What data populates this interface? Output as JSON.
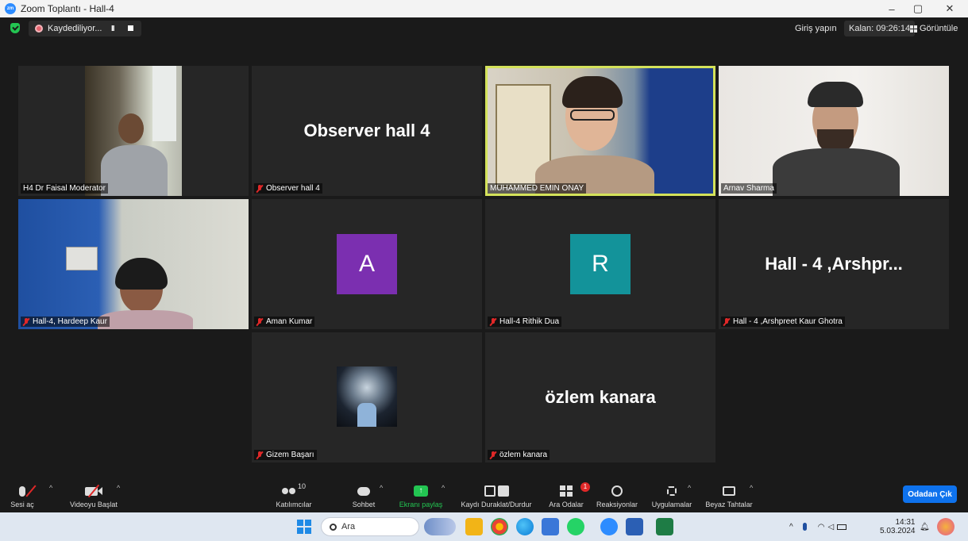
{
  "window": {
    "title": "Zoom Toplantı - Hall-4",
    "minimize": "–",
    "restore": "▢",
    "close": "✕"
  },
  "topbar": {
    "recording_label": "Kaydediliyor...",
    "pause_glyph": "II",
    "signin": "Giriş yapın",
    "remaining": "Kalan: 09:26:14",
    "view_label": "Görüntüle"
  },
  "tiles": [
    {
      "name": "H4 Dr Faisal Moderator",
      "muted": false,
      "type": "video"
    },
    {
      "name": "Observer hall 4",
      "display": "Observer hall 4",
      "muted": true,
      "type": "name"
    },
    {
      "name": "MUHAMMED EMIN ONAY",
      "muted": false,
      "type": "video",
      "active": true
    },
    {
      "name": "Arnav Sharma",
      "muted": false,
      "type": "video"
    },
    {
      "name": "Hall-4, Hardeep Kaur",
      "muted": true,
      "type": "video"
    },
    {
      "name": "Aman Kumar",
      "initial": "A",
      "avatar_color": "#7b2fb0",
      "muted": true,
      "type": "avatar"
    },
    {
      "name": "Hall-4 Rithik Dua",
      "initial": "R",
      "avatar_color": "#13939a",
      "muted": true,
      "type": "avatar"
    },
    {
      "name": "Hall - 4 ,Arshpreet Kaur Ghotra",
      "display": "Hall - 4 ,Arshpr...",
      "muted": true,
      "type": "name"
    },
    {
      "name": "Gizem Başarı",
      "muted": true,
      "type": "picture"
    },
    {
      "name": "özlem kanara",
      "display": "özlem kanara",
      "muted": true,
      "type": "name"
    }
  ],
  "toolbar": {
    "unmute": "Sesi aç",
    "start_video": "Videoyu Başlat",
    "participants": "Katılımcılar",
    "participants_count": "10",
    "chat": "Sohbet",
    "share": "Ekranı paylaş",
    "record": "Kaydı Duraklat/Durdur",
    "breakout": "Ara Odalar",
    "breakout_badge": "1",
    "reactions": "Reaksiyonlar",
    "apps": "Uygulamalar",
    "whiteboards": "Beyaz Tahtalar",
    "leave": "Odadan Çık",
    "caret": "^"
  },
  "taskbar": {
    "search_placeholder": "Ara",
    "time": "14:31",
    "date": "5.03.2024"
  },
  "colors": {
    "accent": "#0e72ed",
    "share_green": "#23c552",
    "active_speaker": "#d4e25a",
    "mute_red": "#e02828"
  }
}
